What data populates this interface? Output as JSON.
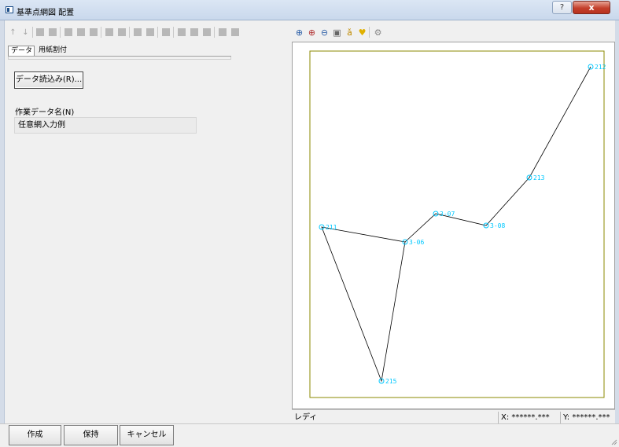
{
  "window": {
    "title": "基準点網図 配置",
    "help_label": "?",
    "close_label": "x"
  },
  "tabs": [
    {
      "label": "データ",
      "active": true
    },
    {
      "label": "用紙割付",
      "active": false
    }
  ],
  "data_panel": {
    "read_button": "データ読込み(R)...",
    "work_data_label": "作業データ名(N)",
    "work_data_value": "任意網入力例"
  },
  "status": {
    "text": "レディ",
    "x": "X: ******.***",
    "y": "Y: ******.***"
  },
  "buttons": {
    "create": "作成",
    "keep": "保持",
    "cancel": "キャンセル"
  },
  "map": {
    "line_color": "#000000",
    "point_color": "#00c8ff",
    "frame_color": "#8b8a00",
    "points": [
      {
        "label": "212"
      },
      {
        "label": "213"
      },
      {
        "label": "3-07"
      },
      {
        "label": "3-08"
      },
      {
        "label": "211"
      },
      {
        "label": "3-06"
      },
      {
        "label": "215"
      }
    ]
  },
  "icons": {
    "left_toolbar": [
      "move-up-icon",
      "move-down-icon",
      "insert-point-icon",
      "delete-point-icon",
      "copy-icon",
      "paste-icon",
      "table-icon",
      "flow-icon",
      "arrow-right-icon",
      "speaker-icon",
      "settings-icon",
      "grid-icon",
      "branch-icon",
      "merge-icon",
      "sort-icon",
      "split-icon",
      "join-icon"
    ],
    "right_toolbar": [
      "zoom-fit-icon",
      "zoom-in-icon",
      "zoom-out-icon",
      "frame-icon",
      "text-icon",
      "bulb-icon",
      "gear-icon"
    ]
  }
}
